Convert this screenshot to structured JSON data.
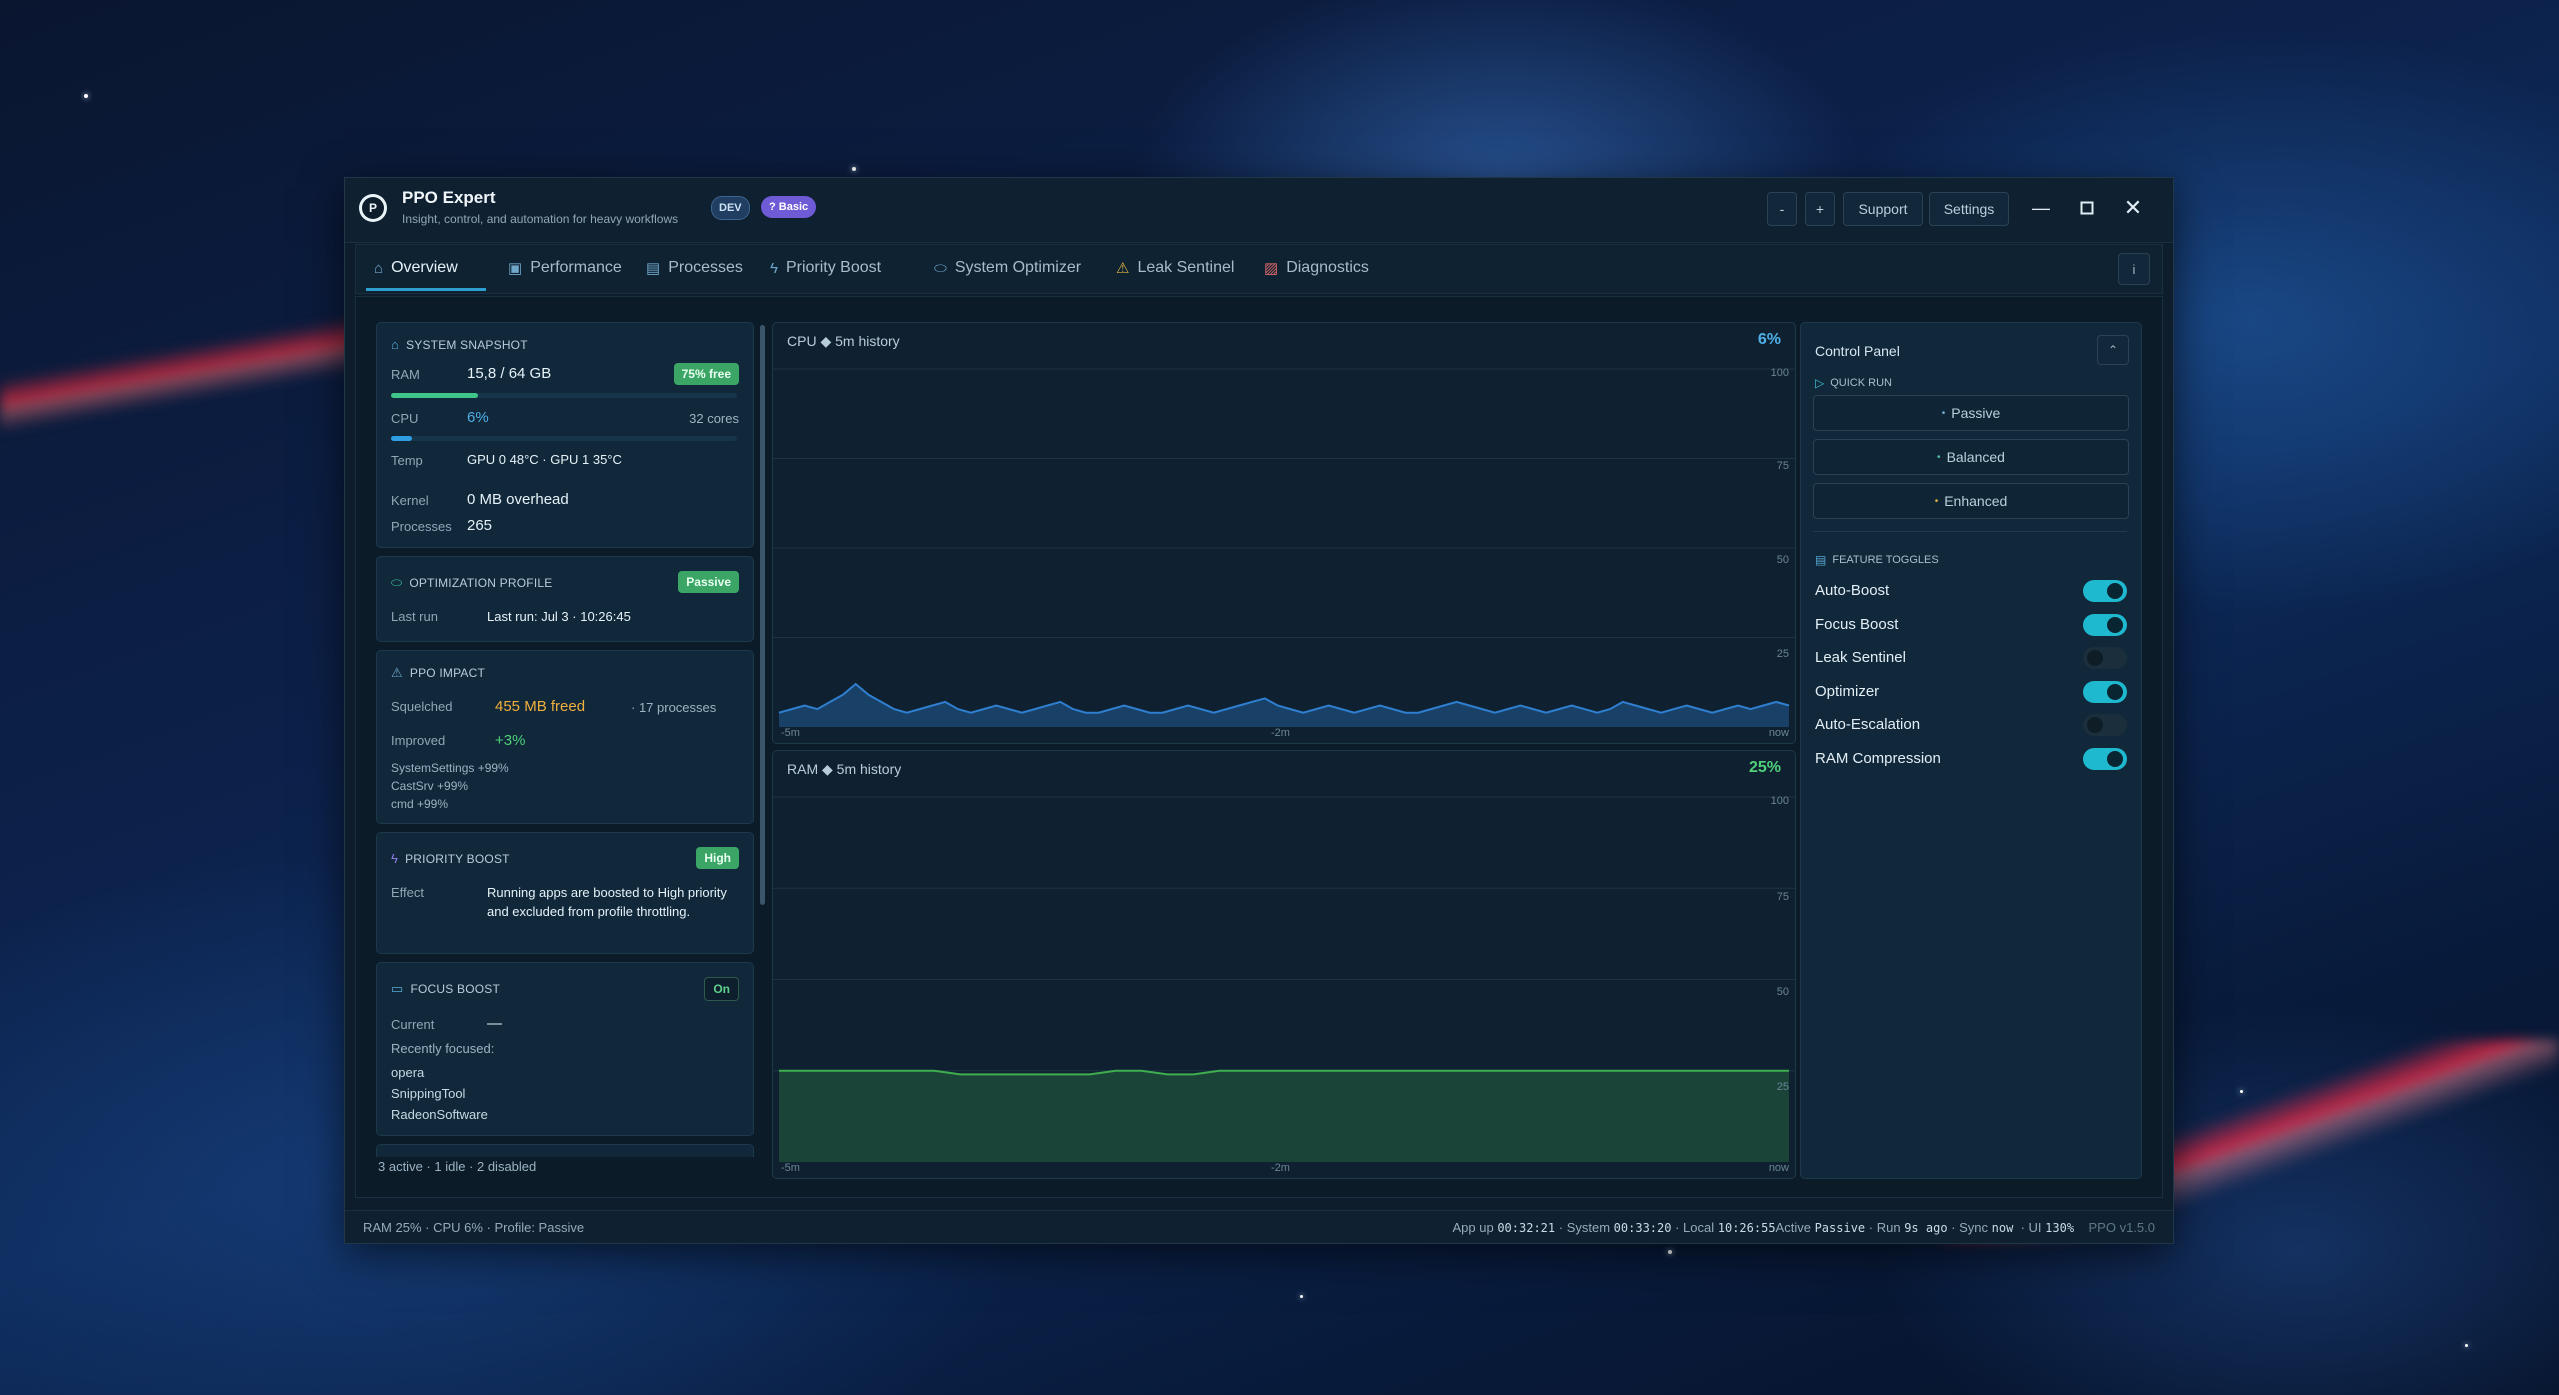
{
  "app": {
    "title": "PPO Expert",
    "subtitle": "Insight, control, and automation for heavy workflows",
    "badge_dev": "DEV",
    "badge_basic": "? Basic",
    "btn_minus": "-",
    "btn_plus": "+",
    "btn_support": "Support",
    "btn_settings": "Settings"
  },
  "tabs": [
    {
      "label": "Overview",
      "icon": "home-icon"
    },
    {
      "label": "Performance",
      "icon": "chart-icon"
    },
    {
      "label": "Processes",
      "icon": "document-icon"
    },
    {
      "label": "Priority Boost",
      "icon": "bolt-icon"
    },
    {
      "label": "System Optimizer",
      "icon": "gamepad-icon"
    },
    {
      "label": "Leak Sentinel",
      "icon": "warning-icon"
    },
    {
      "label": "Diagnostics",
      "icon": "diagnostics-icon"
    }
  ],
  "info_label": "i",
  "snapshot": {
    "header": "SYSTEM SNAPSHOT",
    "ram_label": "RAM",
    "ram_value": "15,8 / 64 GB",
    "ram_badge": "75% free",
    "ram_used_fraction": 0.25,
    "cpu_label": "CPU",
    "cpu_value": "6%",
    "cpu_cores": "32 cores",
    "cpu_fraction": 0.06,
    "temp_label": "Temp",
    "temp_value": "GPU 0 48°C  ·  GPU 1 35°C",
    "kernel_label": "Kernel",
    "kernel_value": "0 MB overhead",
    "processes_label": "Processes",
    "processes_value": "265"
  },
  "opt_profile": {
    "header": "OPTIMIZATION PROFILE",
    "badge": "Passive",
    "last_run_label": "Last run",
    "last_run_value": "Last run: Jul 3 · 10:26:45"
  },
  "impact": {
    "header": "PPO IMPACT",
    "squelched_label": "Squelched",
    "squelched_value": "455 MB freed",
    "squelched_extra": "· 17 processes",
    "improved_label": "Improved",
    "improved_value": "+3%",
    "items": [
      "SystemSettings  +99%",
      "CastSrv  +99%",
      "cmd  +99%"
    ]
  },
  "priority_boost": {
    "header": "PRIORITY BOOST",
    "badge": "High",
    "effect_label": "Effect",
    "effect_value": "Running apps are boosted to High priority and excluded from profile throttling."
  },
  "focus_boost": {
    "header": "FOCUS BOOST",
    "badge": "On",
    "current_label": "Current",
    "current_value": "—",
    "recent_label": "Recently focused:",
    "recent": [
      "opera",
      "SnippingTool",
      "RadeonSoftware"
    ]
  },
  "left_footer": "3 active  ·  1 idle  ·  2 disabled",
  "charts": {
    "cpu": {
      "title": "CPU ◆ 5m history",
      "pct": "6%",
      "color": "#2f7fd0"
    },
    "ram": {
      "title": "RAM ◆ 5m history",
      "pct": "25%",
      "color": "#3fae4e"
    },
    "grid_labels": [
      "100",
      "75",
      "50",
      "25"
    ],
    "x_labels": [
      "-5m",
      "-2m",
      "now"
    ]
  },
  "chart_data": [
    {
      "type": "area",
      "title": "CPU ◆ 5m history",
      "ylim": [
        0,
        100
      ],
      "x": [
        "-5m",
        "-2m",
        "now"
      ],
      "series": [
        {
          "values": [
            4,
            5,
            6,
            5,
            7,
            9,
            12,
            9,
            7,
            5,
            4,
            5,
            6,
            7,
            5,
            4,
            5,
            6,
            5,
            4,
            5,
            6,
            7,
            5,
            4,
            4,
            5,
            6,
            5,
            4,
            4,
            5,
            6,
            5,
            4,
            5,
            6,
            7,
            8,
            6,
            5,
            4,
            5,
            6,
            5,
            4,
            5,
            6,
            5,
            4,
            4,
            5,
            6,
            7,
            6,
            5,
            4,
            5,
            6,
            5,
            4,
            5,
            6,
            5,
            4,
            5,
            7,
            6,
            5,
            4,
            5,
            6,
            5,
            4,
            5,
            6,
            5,
            6,
            7,
            6
          ]
        }
      ]
    },
    {
      "type": "area",
      "title": "RAM ◆ 5m history",
      "ylim": [
        0,
        100
      ],
      "x": [
        "-5m",
        "-2m",
        "now"
      ],
      "series": [
        {
          "values": [
            25,
            25,
            25,
            25,
            25,
            25,
            25,
            24,
            24,
            24,
            24,
            24,
            24,
            25,
            25,
            24,
            24,
            25,
            25,
            25,
            25,
            25,
            25,
            25,
            25,
            25,
            25,
            25,
            25,
            25,
            25,
            25,
            25,
            25,
            25,
            25,
            25,
            25,
            25,
            25
          ]
        }
      ]
    }
  ],
  "control_panel": {
    "title": "Control Panel",
    "quick_run": "QUICK RUN",
    "quick_buttons": [
      "Passive",
      "Balanced",
      "Enhanced"
    ],
    "quick_dot_colors": [
      "#6fb0d9",
      "#4fc0a0",
      "#e0b040"
    ],
    "feature_toggles": "FEATURE TOGGLES",
    "toggles": [
      {
        "label": "Auto-Boost",
        "on": true
      },
      {
        "label": "Focus Boost",
        "on": true
      },
      {
        "label": "Leak Sentinel",
        "on": false
      },
      {
        "label": "Optimizer",
        "on": true
      },
      {
        "label": "Auto-Escalation",
        "on": false
      },
      {
        "label": "RAM Compression",
        "on": true
      }
    ]
  },
  "statusbar": {
    "left": "RAM 25%  ·  CPU 6%  ·  Profile: Passive",
    "app_up_label": "App up",
    "app_up": "00:32:21",
    "system_label": "· System",
    "system": "00:33:20",
    "local_label": "· Local",
    "local": "10:26:55",
    "active_label": "Active",
    "active": "Passive",
    "run_label": "· Run",
    "run": "9s ago",
    "sync_label": "· Sync",
    "sync": "now",
    "ui_label": "· UI",
    "ui": "130%",
    "version": "PPO v1.5.0"
  }
}
